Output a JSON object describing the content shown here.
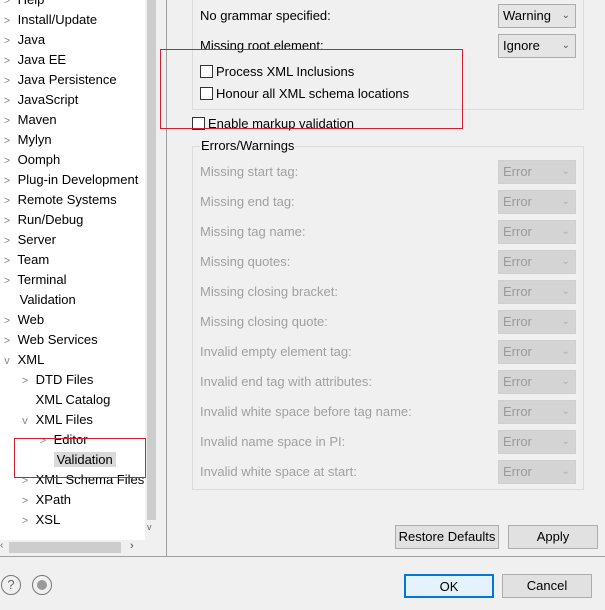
{
  "tree": [
    {
      "label": "Help",
      "chev": ">",
      "indent": 0
    },
    {
      "label": "Install/Update",
      "chev": ">",
      "indent": 0
    },
    {
      "label": "Java",
      "chev": ">",
      "indent": 0
    },
    {
      "label": "Java EE",
      "chev": ">",
      "indent": 0
    },
    {
      "label": "Java Persistence",
      "chev": ">",
      "indent": 0
    },
    {
      "label": "JavaScript",
      "chev": ">",
      "indent": 0
    },
    {
      "label": "Maven",
      "chev": ">",
      "indent": 0
    },
    {
      "label": "Mylyn",
      "chev": ">",
      "indent": 0
    },
    {
      "label": "Oomph",
      "chev": ">",
      "indent": 0
    },
    {
      "label": "Plug-in Development",
      "chev": ">",
      "indent": 0
    },
    {
      "label": "Remote Systems",
      "chev": ">",
      "indent": 0
    },
    {
      "label": "Run/Debug",
      "chev": ">",
      "indent": 0
    },
    {
      "label": "Server",
      "chev": ">",
      "indent": 0
    },
    {
      "label": "Team",
      "chev": ">",
      "indent": 0
    },
    {
      "label": "Terminal",
      "chev": ">",
      "indent": 0
    },
    {
      "label": "Validation",
      "chev": "",
      "indent": 0
    },
    {
      "label": "Web",
      "chev": ">",
      "indent": 0
    },
    {
      "label": "Web Services",
      "chev": ">",
      "indent": 0
    },
    {
      "label": "XML",
      "chev": "v",
      "indent": 0
    },
    {
      "label": "DTD Files",
      "chev": ">",
      "indent": 1
    },
    {
      "label": "XML Catalog",
      "chev": "",
      "indent": 1
    },
    {
      "label": "XML Files",
      "chev": "v",
      "indent": 1
    },
    {
      "label": "Editor",
      "chev": ">",
      "indent": 2
    },
    {
      "label": "Validation",
      "chev": "",
      "indent": 2,
      "selected": true
    },
    {
      "label": "XML Schema Files",
      "chev": ">",
      "indent": 1
    },
    {
      "label": "XPath",
      "chev": ">",
      "indent": 1
    },
    {
      "label": "XSL",
      "chev": ">",
      "indent": 1
    }
  ],
  "settings": {
    "no_grammar": {
      "label": "No grammar specified:",
      "value": "Warning"
    },
    "missing_root": {
      "label": "Missing root element:",
      "value": "Ignore"
    },
    "process_xml_inclusions": {
      "label": "Process XML Inclusions",
      "checked": false
    },
    "honour_schema": {
      "label": "Honour all XML schema locations",
      "checked": false
    },
    "enable_markup": {
      "label": "Enable markup validation",
      "checked": false
    }
  },
  "errors_group": {
    "title": "Errors/Warnings",
    "rows": [
      {
        "label": "Missing start tag:",
        "value": "Error"
      },
      {
        "label": "Missing end tag:",
        "value": "Error"
      },
      {
        "label": "Missing tag name:",
        "value": "Error"
      },
      {
        "label": "Missing quotes:",
        "value": "Error"
      },
      {
        "label": "Missing closing bracket:",
        "value": "Error"
      },
      {
        "label": "Missing closing quote:",
        "value": "Error"
      },
      {
        "label": "Invalid empty element tag:",
        "value": "Error"
      },
      {
        "label": "Invalid end tag with attributes:",
        "value": "Error"
      },
      {
        "label": "Invalid white space before tag name:",
        "value": "Error"
      },
      {
        "label": "Invalid name space in PI:",
        "value": "Error"
      },
      {
        "label": "Invalid white space at start:",
        "value": "Error"
      }
    ]
  },
  "buttons": {
    "restore": "Restore Defaults",
    "apply": "Apply",
    "ok": "OK",
    "cancel": "Cancel",
    "help": "?"
  },
  "colors": {
    "highlight_box": "#d02030",
    "ok_border": "#0078d7"
  }
}
